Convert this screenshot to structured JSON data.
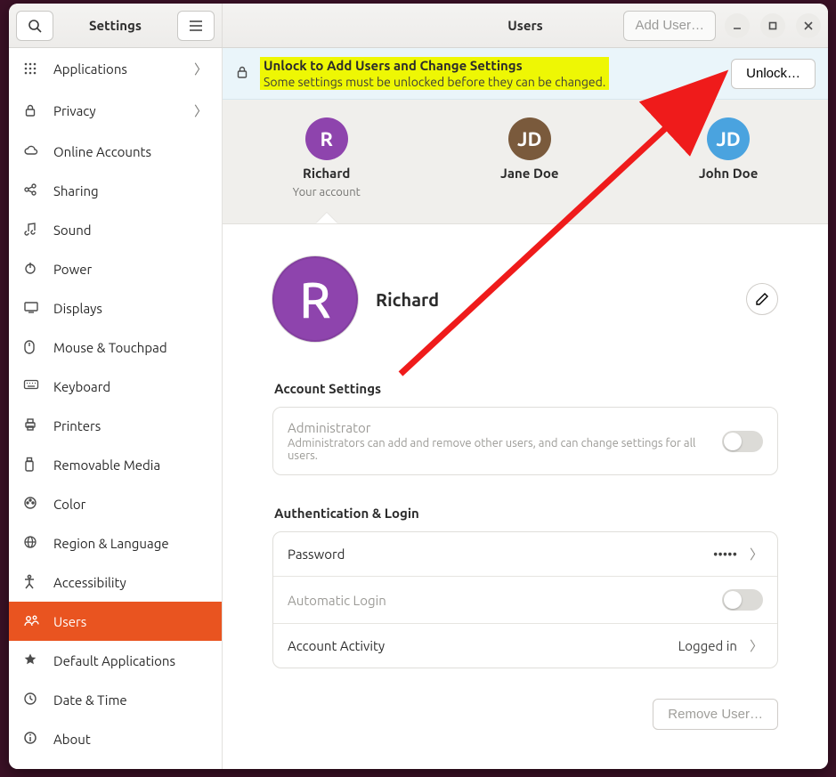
{
  "header": {
    "settings_title": "Settings",
    "panel_title": "Users",
    "add_user_label": "Add User…"
  },
  "sidebar": {
    "items": [
      {
        "icon": "grid",
        "label": "Applications",
        "chevron": true
      },
      {
        "icon": "lock",
        "label": "Privacy",
        "chevron": true
      },
      {
        "icon": "cloud",
        "label": "Online Accounts",
        "chevron": false
      },
      {
        "icon": "share",
        "label": "Sharing",
        "chevron": false
      },
      {
        "icon": "music",
        "label": "Sound",
        "chevron": false
      },
      {
        "icon": "power",
        "label": "Power",
        "chevron": false
      },
      {
        "icon": "display",
        "label": "Displays",
        "chevron": false
      },
      {
        "icon": "mouse",
        "label": "Mouse & Touchpad",
        "chevron": false
      },
      {
        "icon": "keyboard",
        "label": "Keyboard",
        "chevron": false
      },
      {
        "icon": "printer",
        "label": "Printers",
        "chevron": false
      },
      {
        "icon": "usb",
        "label": "Removable Media",
        "chevron": false
      },
      {
        "icon": "color",
        "label": "Color",
        "chevron": false
      },
      {
        "icon": "globe",
        "label": "Region & Language",
        "chevron": false
      },
      {
        "icon": "a11y",
        "label": "Accessibility",
        "chevron": false
      },
      {
        "icon": "users",
        "label": "Users",
        "chevron": false,
        "active": true
      },
      {
        "icon": "star",
        "label": "Default Applications",
        "chevron": false
      },
      {
        "icon": "clock",
        "label": "Date & Time",
        "chevron": false
      },
      {
        "icon": "info",
        "label": "About",
        "chevron": false
      }
    ]
  },
  "unlock_banner": {
    "title": "Unlock to Add Users and Change Settings",
    "desc": "Some settings must be unlocked before they can be changed.",
    "button": "Unlock…"
  },
  "users": [
    {
      "initial": "R",
      "name": "Richard",
      "sub": "Your account",
      "color": "#8e44ad",
      "active": true
    },
    {
      "initial": "JD",
      "name": "Jane Doe",
      "sub": "",
      "color": "#7a5a3c",
      "active": false
    },
    {
      "initial": "JD",
      "name": "John Doe",
      "sub": "",
      "color": "#4aa3df",
      "active": false
    }
  ],
  "detail": {
    "avatar_initial": "R",
    "avatar_color": "#8e44ad",
    "name": "Richard",
    "sections": {
      "account_settings_title": "Account Settings",
      "auth_title": "Authentication & Login"
    },
    "admin_row": {
      "label": "Administrator",
      "desc": "Administrators can add and remove other users, and can change settings for all users."
    },
    "password_row": {
      "label": "Password",
      "value": "•••••"
    },
    "autologin_row": {
      "label": "Automatic Login"
    },
    "activity_row": {
      "label": "Account Activity",
      "value": "Logged in"
    },
    "remove_user_label": "Remove User…"
  }
}
